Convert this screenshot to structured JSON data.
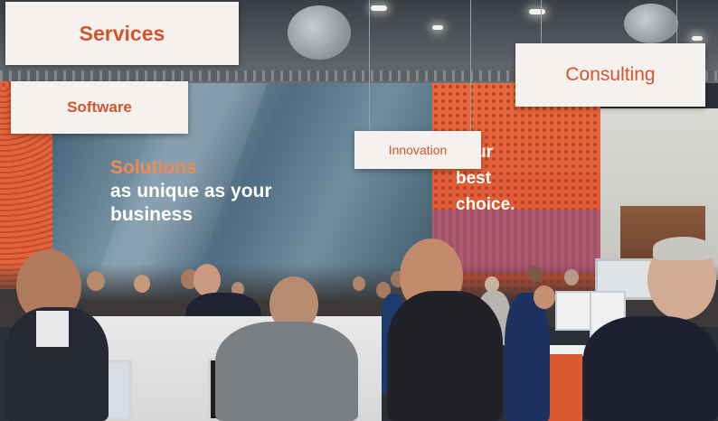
{
  "photo": {
    "signs": {
      "services": "Services",
      "software": "Software",
      "innovation": "Innovation",
      "consulting": "Consulting"
    },
    "screen_headline": {
      "line1": "Solutions",
      "line2": "as unique as your",
      "line3": "business"
    },
    "wall_slogan": {
      "line1": "ur",
      "line2": "best",
      "line3": "choice."
    },
    "colors": {
      "brand_orange": "#d5542e",
      "sign_background": "#f4f1ee",
      "headline_accent": "#ef8a55"
    }
  }
}
